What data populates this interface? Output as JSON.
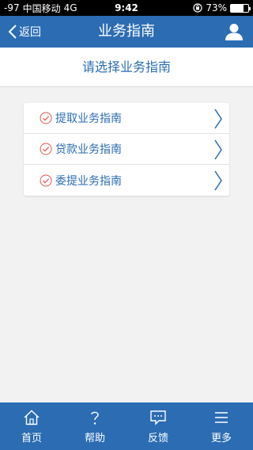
{
  "status_bar": {
    "signal": "-97",
    "carrier": "中国移动",
    "network": "4G",
    "time": "9:42",
    "battery_percent": "73%",
    "battery_level": 0.73
  },
  "nav": {
    "back_label": "返回",
    "title": "业务指南",
    "user_icon": "user-icon"
  },
  "subheader": {
    "text": "请选择业务指南"
  },
  "guides": [
    {
      "label": "提取业务指南"
    },
    {
      "label": "贷款业务指南"
    },
    {
      "label": "委提业务指南"
    }
  ],
  "tabs": [
    {
      "label": "首页",
      "icon": "home-icon"
    },
    {
      "label": "帮助",
      "icon": "help-icon"
    },
    {
      "label": "反馈",
      "icon": "feedback-icon"
    },
    {
      "label": "更多",
      "icon": "menu-icon"
    }
  ],
  "colors": {
    "primary": "#2b6cb3",
    "check": "#e2574c",
    "background": "#f2f2f2"
  }
}
